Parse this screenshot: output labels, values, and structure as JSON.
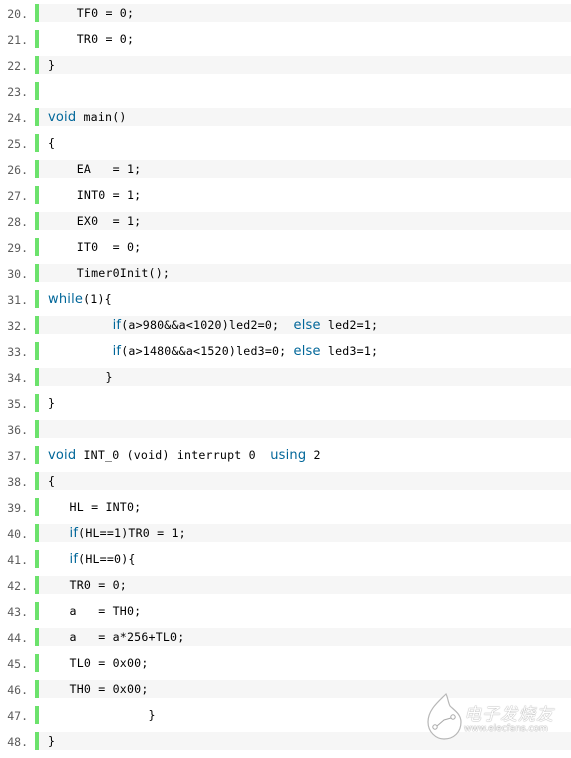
{
  "colors": {
    "gutter_bar": "#6ce26c",
    "keyword": "#006699",
    "line_number": "#5c5c5c",
    "shaded_row": "#f6f6f6"
  },
  "code": {
    "language": "c",
    "lines": [
      {
        "number": "20.",
        "segments": [
          {
            "text": "    TF0 = 0;",
            "kw": false
          }
        ]
      },
      {
        "number": "21.",
        "segments": [
          {
            "text": "    TR0 = 0;",
            "kw": false
          }
        ]
      },
      {
        "number": "22.",
        "segments": [
          {
            "text": "}",
            "kw": false
          }
        ]
      },
      {
        "number": "23.",
        "segments": [
          {
            "text": "",
            "kw": false
          }
        ]
      },
      {
        "number": "24.",
        "segments": [
          {
            "text": "void",
            "kw": true
          },
          {
            "text": " main()",
            "kw": false
          }
        ]
      },
      {
        "number": "25.",
        "segments": [
          {
            "text": "{",
            "kw": false
          }
        ]
      },
      {
        "number": "26.",
        "segments": [
          {
            "text": "    EA   = 1;",
            "kw": false
          }
        ]
      },
      {
        "number": "27.",
        "segments": [
          {
            "text": "    INT0 = 1;",
            "kw": false
          }
        ]
      },
      {
        "number": "28.",
        "segments": [
          {
            "text": "    EX0  = 1;",
            "kw": false
          }
        ]
      },
      {
        "number": "29.",
        "segments": [
          {
            "text": "    IT0  = 0;",
            "kw": false
          }
        ]
      },
      {
        "number": "30.",
        "segments": [
          {
            "text": "    Timer0Init();",
            "kw": false
          }
        ]
      },
      {
        "number": "31.",
        "segments": [
          {
            "text": "while",
            "kw": true
          },
          {
            "text": "(1){",
            "kw": false
          }
        ]
      },
      {
        "number": "32.",
        "segments": [
          {
            "text": "         ",
            "kw": false
          },
          {
            "text": "if",
            "kw": true
          },
          {
            "text": "(a>980&&a<1020)led2=0;  ",
            "kw": false
          },
          {
            "text": "else",
            "kw": true
          },
          {
            "text": " led2=1;",
            "kw": false
          }
        ]
      },
      {
        "number": "33.",
        "segments": [
          {
            "text": "         ",
            "kw": false
          },
          {
            "text": "if",
            "kw": true
          },
          {
            "text": "(a>1480&&a<1520)led3=0; ",
            "kw": false
          },
          {
            "text": "else",
            "kw": true
          },
          {
            "text": " led3=1;",
            "kw": false
          }
        ]
      },
      {
        "number": "34.",
        "segments": [
          {
            "text": "        }",
            "kw": false
          }
        ]
      },
      {
        "number": "35.",
        "segments": [
          {
            "text": "}",
            "kw": false
          }
        ]
      },
      {
        "number": "36.",
        "segments": [
          {
            "text": "",
            "kw": false
          }
        ]
      },
      {
        "number": "37.",
        "segments": [
          {
            "text": "void",
            "kw": true
          },
          {
            "text": " INT_0 (void) interrupt 0  ",
            "kw": false
          },
          {
            "text": "using",
            "kw": true
          },
          {
            "text": " 2",
            "kw": false
          }
        ]
      },
      {
        "number": "38.",
        "segments": [
          {
            "text": "{",
            "kw": false
          }
        ]
      },
      {
        "number": "39.",
        "segments": [
          {
            "text": "   HL = INT0;",
            "kw": false
          }
        ]
      },
      {
        "number": "40.",
        "segments": [
          {
            "text": "   ",
            "kw": false
          },
          {
            "text": "if",
            "kw": true
          },
          {
            "text": "(HL==1)TR0 = 1;",
            "kw": false
          }
        ]
      },
      {
        "number": "41.",
        "segments": [
          {
            "text": "   ",
            "kw": false
          },
          {
            "text": "if",
            "kw": true
          },
          {
            "text": "(HL==0){",
            "kw": false
          }
        ]
      },
      {
        "number": "42.",
        "segments": [
          {
            "text": "   TR0 = 0;",
            "kw": false
          }
        ]
      },
      {
        "number": "43.",
        "segments": [
          {
            "text": "   a   = TH0;",
            "kw": false
          }
        ]
      },
      {
        "number": "44.",
        "segments": [
          {
            "text": "   a   = a*256+TL0;",
            "kw": false
          }
        ]
      },
      {
        "number": "45.",
        "segments": [
          {
            "text": "   TL0 = 0x00;",
            "kw": false
          }
        ]
      },
      {
        "number": "46.",
        "segments": [
          {
            "text": "   TH0 = 0x00;",
            "kw": false
          }
        ]
      },
      {
        "number": "47.",
        "segments": [
          {
            "text": "              }",
            "kw": false
          }
        ]
      },
      {
        "number": "48.",
        "segments": [
          {
            "text": "}",
            "kw": false
          }
        ]
      }
    ]
  },
  "watermark": {
    "title": "电子发烧友",
    "url": "www.elecfans.com",
    "icon": "elecfans-logo-icon"
  }
}
